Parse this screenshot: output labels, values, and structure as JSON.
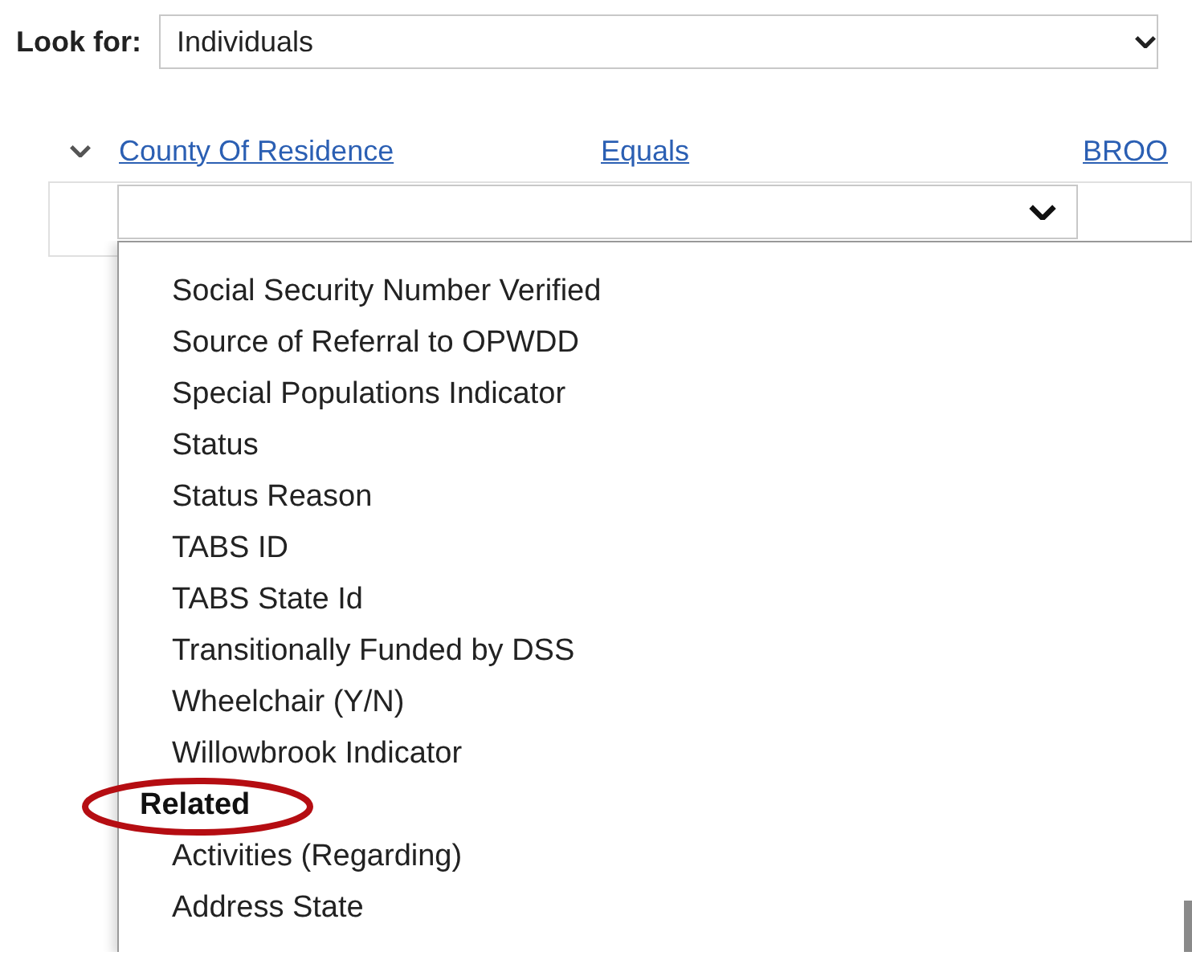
{
  "look_for": {
    "label": "Look for:",
    "value": "Individuals"
  },
  "condition": {
    "expanded": true,
    "field": "County Of Residence",
    "operator": "Equals",
    "value": "BROO"
  },
  "field_picker": {
    "expanded": true
  },
  "options": [
    {
      "kind": "option",
      "label": "Social Security Number Verified",
      "highlighted": false
    },
    {
      "kind": "option",
      "label": "Source of Referral to OPWDD",
      "highlighted": false
    },
    {
      "kind": "option",
      "label": "Special Populations Indicator",
      "highlighted": false
    },
    {
      "kind": "option",
      "label": "Status",
      "highlighted": false
    },
    {
      "kind": "option",
      "label": "Status Reason",
      "highlighted": false
    },
    {
      "kind": "option",
      "label": "TABS ID",
      "highlighted": false
    },
    {
      "kind": "option",
      "label": "TABS State Id",
      "highlighted": false
    },
    {
      "kind": "option",
      "label": "Transitionally Funded by DSS",
      "highlighted": false
    },
    {
      "kind": "option",
      "label": "Wheelchair (Y/N)",
      "highlighted": false
    },
    {
      "kind": "option",
      "label": "Willowbrook Indicator",
      "highlighted": false
    },
    {
      "kind": "group",
      "label": "Related",
      "highlighted": true
    },
    {
      "kind": "option",
      "label": "Activities (Regarding)",
      "highlighted": false
    },
    {
      "kind": "option",
      "label": "Address State",
      "highlighted": false
    }
  ]
}
